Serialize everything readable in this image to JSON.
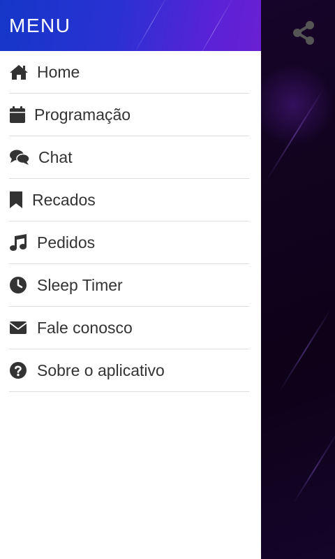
{
  "drawer": {
    "title": "MENU",
    "items": [
      {
        "label": "Home",
        "icon": "home-icon"
      },
      {
        "label": "Programação",
        "icon": "calendar-icon"
      },
      {
        "label": "Chat",
        "icon": "chat-icon"
      },
      {
        "label": "Recados",
        "icon": "bookmark-icon"
      },
      {
        "label": "Pedidos",
        "icon": "music-note-icon"
      },
      {
        "label": "Sleep Timer",
        "icon": "clock-icon"
      },
      {
        "label": "Fale conosco",
        "icon": "envelope-icon"
      },
      {
        "label": "Sobre o aplicativo",
        "icon": "question-circle-icon"
      }
    ]
  },
  "share": {
    "icon": "share-icon"
  },
  "colors": {
    "header_start": "#1537c8",
    "header_end": "#6a1fd2",
    "menu_text": "#333333",
    "divider": "#dddddd",
    "background_dark": "#12031f",
    "share_icon": "#555555"
  }
}
